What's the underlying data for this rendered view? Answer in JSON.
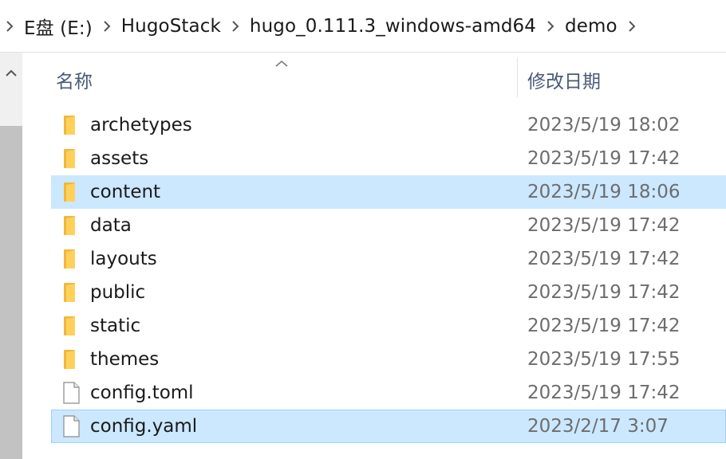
{
  "breadcrumb": {
    "items": [
      {
        "label": "E盘 (E:)"
      },
      {
        "label": "HugoStack"
      },
      {
        "label": "hugo_0.111.3_windows-amd64"
      },
      {
        "label": "demo"
      }
    ]
  },
  "columns": {
    "name": "名称",
    "date_modified": "修改日期",
    "sort_indicator": "ascending"
  },
  "files": [
    {
      "name": "archetypes",
      "date": "2023/5/19 18:02",
      "type": "folder",
      "state": "normal"
    },
    {
      "name": "assets",
      "date": "2023/5/19 17:42",
      "type": "folder",
      "state": "normal"
    },
    {
      "name": "content",
      "date": "2023/5/19 18:06",
      "type": "folder",
      "state": "selected"
    },
    {
      "name": "data",
      "date": "2023/5/19 17:42",
      "type": "folder",
      "state": "normal"
    },
    {
      "name": "layouts",
      "date": "2023/5/19 17:42",
      "type": "folder",
      "state": "normal"
    },
    {
      "name": "public",
      "date": "2023/5/19 17:42",
      "type": "folder",
      "state": "normal"
    },
    {
      "name": "static",
      "date": "2023/5/19 17:42",
      "type": "folder",
      "state": "normal"
    },
    {
      "name": "themes",
      "date": "2023/5/19 17:55",
      "type": "folder",
      "state": "normal"
    },
    {
      "name": "config.toml",
      "date": "2023/5/19 17:42",
      "type": "file",
      "state": "normal"
    },
    {
      "name": "config.yaml",
      "date": "2023/2/17 3:07",
      "type": "file",
      "state": "focused"
    }
  ],
  "icons": {
    "folder": "folder-icon",
    "file": "file-icon",
    "breadcrumb_separator": "chevron-right-icon",
    "scroll_up": "chevron-up-icon",
    "sort": "sort-ascending-icon"
  },
  "colors": {
    "selection": "#cce8ff",
    "focus_border": "#99d1ff",
    "header_text": "#4a5a78",
    "date_text": "#6d6d6d",
    "folder_yellow": "#ffd15c"
  }
}
